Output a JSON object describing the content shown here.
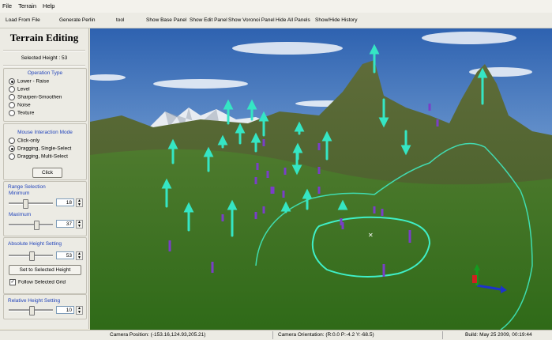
{
  "menu": [
    "File",
    "Terrain",
    "Help"
  ],
  "toolbar": {
    "load": "Load From File",
    "perlin": "Generate Perlin",
    "tool": "tool",
    "base": "Show Base Panel",
    "edit": "Show Edit Panel",
    "voronoi": "Show Voronoi Panel",
    "hide_all": "Hide All Panels",
    "history": "Show/Hide History"
  },
  "panel": {
    "title": "Terrain Editing",
    "selected_height": "Selected Height :   53",
    "operation": {
      "title": "Operation Type",
      "options": [
        "Lower - Raise",
        "Level",
        "Sharpen-Smoothen",
        "Noise",
        "Texture"
      ]
    },
    "mouse": {
      "title": "Mouse Interaction Mode",
      "options": [
        "Click-only",
        "Dragging, Single-Select",
        "Dragging, Multi-Select"
      ],
      "click_label": "Click"
    },
    "range": {
      "title": "Range Selection",
      "min_label": "Minimum",
      "min_value": "18",
      "max_label": "Maximum",
      "max_value": "37"
    },
    "absolute": {
      "title": "Absolute Height Setting",
      "value": "53",
      "set_button": "Set to Selected Height",
      "follow_label": "Follow Selected Grid",
      "follow_checked": true
    },
    "relative": {
      "title": "Relative Height Setting",
      "value": "10"
    }
  },
  "status": {
    "camera_position": "Camera Position: (-153.16,124.93,205.21)",
    "camera_orientation": "Camera Orientation: (R:0.0 P:-4.2 Y:-68.5)",
    "build": "Build: May 25 2009, 00:19:44"
  },
  "colors": {
    "arrow": "#35e6c4",
    "marker": "#7a3ec8",
    "selection": "#3ff0c8",
    "grass": "#3f7a24",
    "sky": "#4a83c6"
  }
}
